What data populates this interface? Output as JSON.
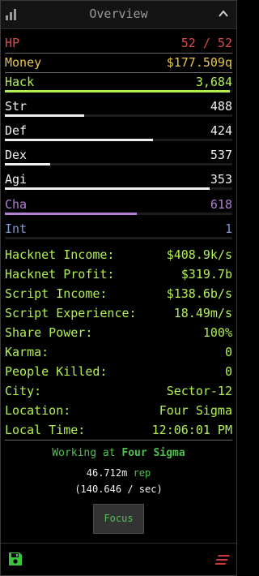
{
  "header": {
    "title": "Overview",
    "stats_icon": "bar-chart-icon",
    "collapse_icon": "chevron-up-icon"
  },
  "stats": {
    "hp": {
      "label": "HP",
      "value": "52 / 52"
    },
    "money": {
      "label": "Money",
      "value": "$177.509q"
    },
    "hack": {
      "label": "Hack",
      "value": "3,684",
      "progress": 0.99
    },
    "str": {
      "label": "Str",
      "value": "488",
      "progress": 0.35
    },
    "def": {
      "label": "Def",
      "value": "424",
      "progress": 0.65
    },
    "dex": {
      "label": "Dex",
      "value": "537",
      "progress": 0.2
    },
    "agi": {
      "label": "Agi",
      "value": "353",
      "progress": 0.9
    },
    "cha": {
      "label": "Cha",
      "value": "618",
      "progress": 0.58
    },
    "int": {
      "label": "Int",
      "value": "1",
      "progress": 0.0
    }
  },
  "info": [
    {
      "label": "Hacknet Income:",
      "value": "$408.9k/s"
    },
    {
      "label": "Hacknet Profit:",
      "value": "$319.7b"
    },
    {
      "label": "Script Income:",
      "value": "$138.6b/s"
    },
    {
      "label": "Script Experience:",
      "value": "18.49m/s"
    },
    {
      "label": "Share Power:",
      "value": "100%"
    },
    {
      "label": "Karma:",
      "value": "0"
    },
    {
      "label": "People Killed:",
      "value": "0"
    },
    {
      "label": "City:",
      "value": "Sector-12"
    },
    {
      "label": "Location:",
      "value": "Four Sigma"
    },
    {
      "label": "Local Time:",
      "value": "12:06:01 PM"
    }
  ],
  "work": {
    "prefix": "Working at",
    "company": "Four Sigma",
    "rep_value": "46.712m",
    "rep_unit": "rep",
    "rate": "(140.646 / sec)",
    "focus_label": "Focus"
  },
  "footer": {
    "save_icon": "save-icon",
    "menu_icon": "menu-icon"
  },
  "colors": {
    "hp": "#e04a4a",
    "money": "#e8c84a",
    "hack": "#b0f050",
    "combat": "#f0f0f0",
    "cha": "#b37ed6",
    "int": "#7d9bd6",
    "work": "#4fc150"
  }
}
